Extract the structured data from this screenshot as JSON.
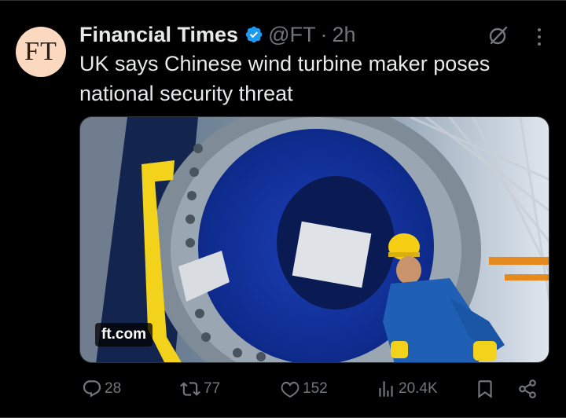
{
  "tweet": {
    "author_name": "Financial Times",
    "handle": "@FT",
    "separator": "·",
    "time": "2h",
    "avatar_text": "FT",
    "verified_icon": "verified-badge-icon",
    "text": "UK says Chinese wind turbine maker poses national security threat",
    "link_card": {
      "domain": "ft.com",
      "image_description_icon": "wind-turbine-photo"
    },
    "actions": {
      "replies": "28",
      "reposts": "77",
      "likes": "152",
      "views": "20.4K"
    }
  },
  "colors": {
    "background": "#000000",
    "text_primary": "#e7e9ea",
    "text_secondary": "#71767b",
    "verified_blue": "#1d9bf0",
    "avatar_bg": "#fbd8c0",
    "border": "#2f3336"
  },
  "icons": {
    "grok": "grok-slash-circle-icon",
    "more": "more-dots-icon",
    "reply": "reply-bubble-icon",
    "repost": "repost-arrows-icon",
    "like": "heart-icon",
    "views": "bar-chart-icon",
    "bookmark": "bookmark-icon",
    "share": "share-icon"
  }
}
